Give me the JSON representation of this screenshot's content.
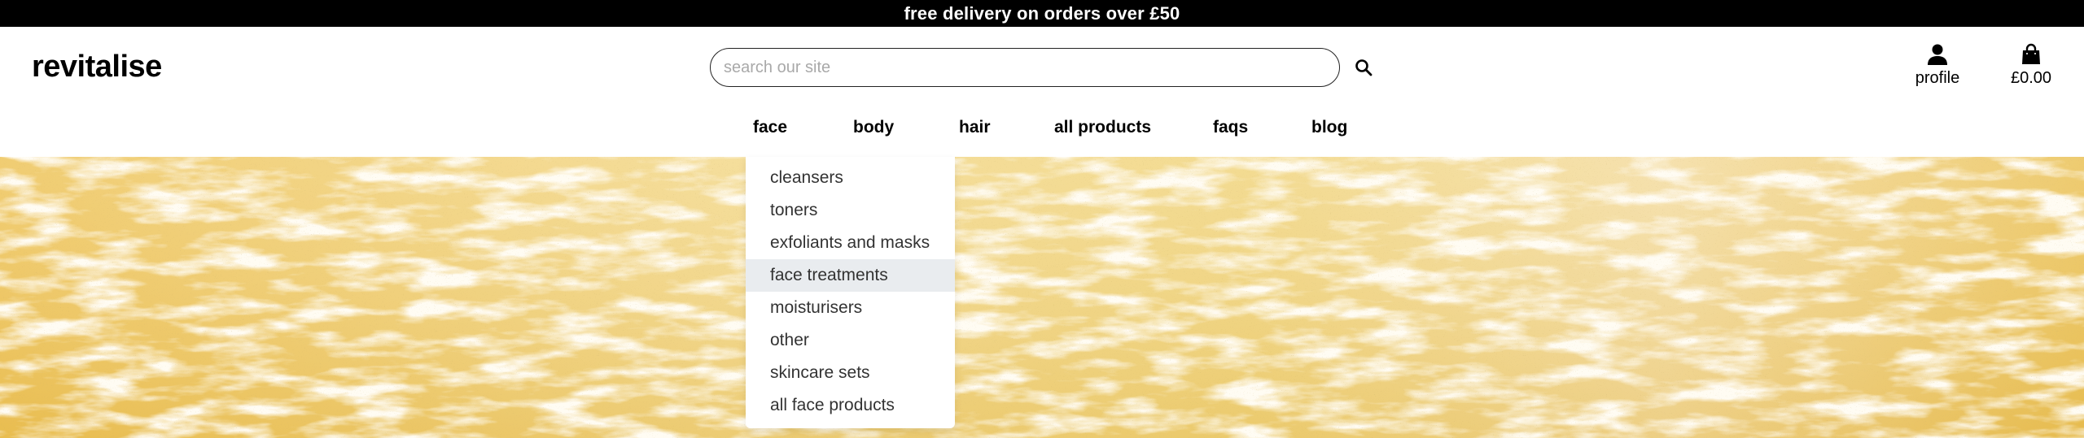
{
  "promo": {
    "text": "free delivery on orders over £50"
  },
  "brand": {
    "name": "revitalise"
  },
  "search": {
    "placeholder": "search our site",
    "value": ""
  },
  "account": {
    "label": "profile",
    "icon": "person-icon"
  },
  "cart": {
    "total": "£0.00",
    "icon": "shopping-bag-icon"
  },
  "nav": {
    "items": [
      {
        "label": "face"
      },
      {
        "label": "body"
      },
      {
        "label": "hair"
      },
      {
        "label": "all products"
      },
      {
        "label": "faqs"
      },
      {
        "label": "blog"
      }
    ]
  },
  "face_menu": {
    "items": [
      {
        "label": "cleansers"
      },
      {
        "label": "toners"
      },
      {
        "label": "exfoliants and masks"
      },
      {
        "label": "face treatments",
        "highlighted": true
      },
      {
        "label": "moisturisers"
      },
      {
        "label": "other"
      },
      {
        "label": "skincare sets"
      },
      {
        "label": "all face products"
      }
    ]
  },
  "colors": {
    "promo_bg": "#000000",
    "hero_base": "#f0cf6a",
    "menu_highlight": "#e9ecef"
  }
}
